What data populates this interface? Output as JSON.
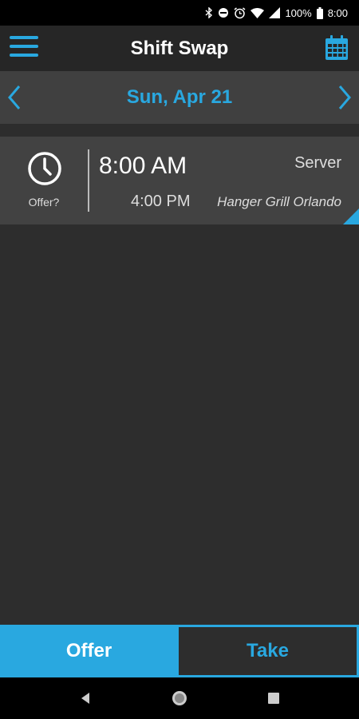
{
  "status_bar": {
    "battery": "100%",
    "time": "8:00",
    "icons": [
      "bluetooth-icon",
      "do-not-disturb-icon",
      "alarm-icon",
      "wifi-icon",
      "cell-signal-icon",
      "battery-icon"
    ]
  },
  "app_bar": {
    "title": "Shift Swap",
    "menu_icon": "hamburger-menu-icon",
    "calendar_icon": "calendar-icon"
  },
  "date_nav": {
    "date": "Sun, Apr 21",
    "prev_icon": "chevron-left-icon",
    "next_icon": "chevron-right-icon"
  },
  "shift": {
    "offer_label": "Offer?",
    "start_time": "8:00 AM",
    "end_time": "4:00 PM",
    "role": "Server",
    "location": "Hanger Grill Orlando"
  },
  "tabs": [
    {
      "label": "Offer",
      "active": true
    },
    {
      "label": "Take",
      "active": false
    }
  ],
  "colors": {
    "accent": "#29a8e0",
    "background": "#2d2d2d",
    "card": "#424242",
    "app_bar": "#262626",
    "date_bar": "#404040"
  },
  "system_nav": [
    "back-icon",
    "home-icon",
    "recents-icon"
  ]
}
